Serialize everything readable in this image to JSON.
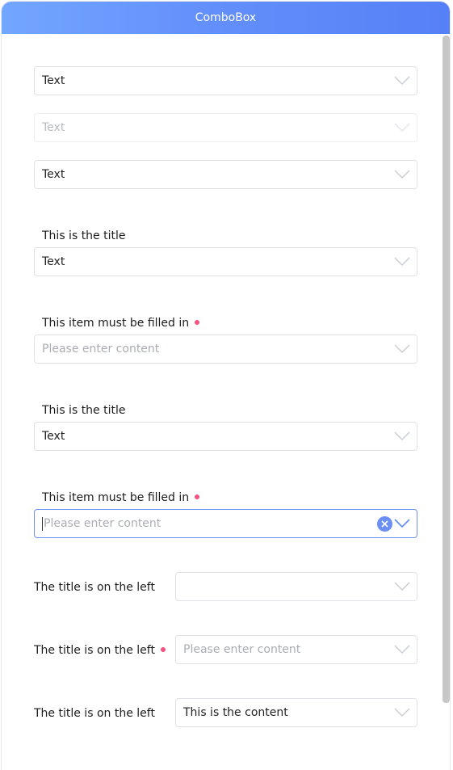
{
  "window": {
    "title": "ComboBox"
  },
  "colors": {
    "accent": "#5f8cf8",
    "required": "#f2537f",
    "border": "#dfe2e8"
  },
  "combos": {
    "basic": {
      "value": "Text"
    },
    "disabled": {
      "value": "Text"
    },
    "basic2": {
      "value": "Text"
    },
    "titled1": {
      "title": "This is the title",
      "value": "Text"
    },
    "required1": {
      "title": "This item must be filled in",
      "placeholder": "Please enter content"
    },
    "titled2": {
      "title": "This is the title",
      "value": "Text"
    },
    "required2": {
      "title": "This item must be filled in",
      "placeholder": "Please enter content"
    },
    "left1": {
      "title": "The title is on the left",
      "value": ""
    },
    "left2": {
      "title": "The title is on the left",
      "placeholder": "Please enter content"
    },
    "left3": {
      "title": "The title is on the left",
      "value": "This is the content"
    }
  },
  "icons": {
    "dropdown": "chevron-down-icon",
    "clear": "clear-circle-icon"
  }
}
